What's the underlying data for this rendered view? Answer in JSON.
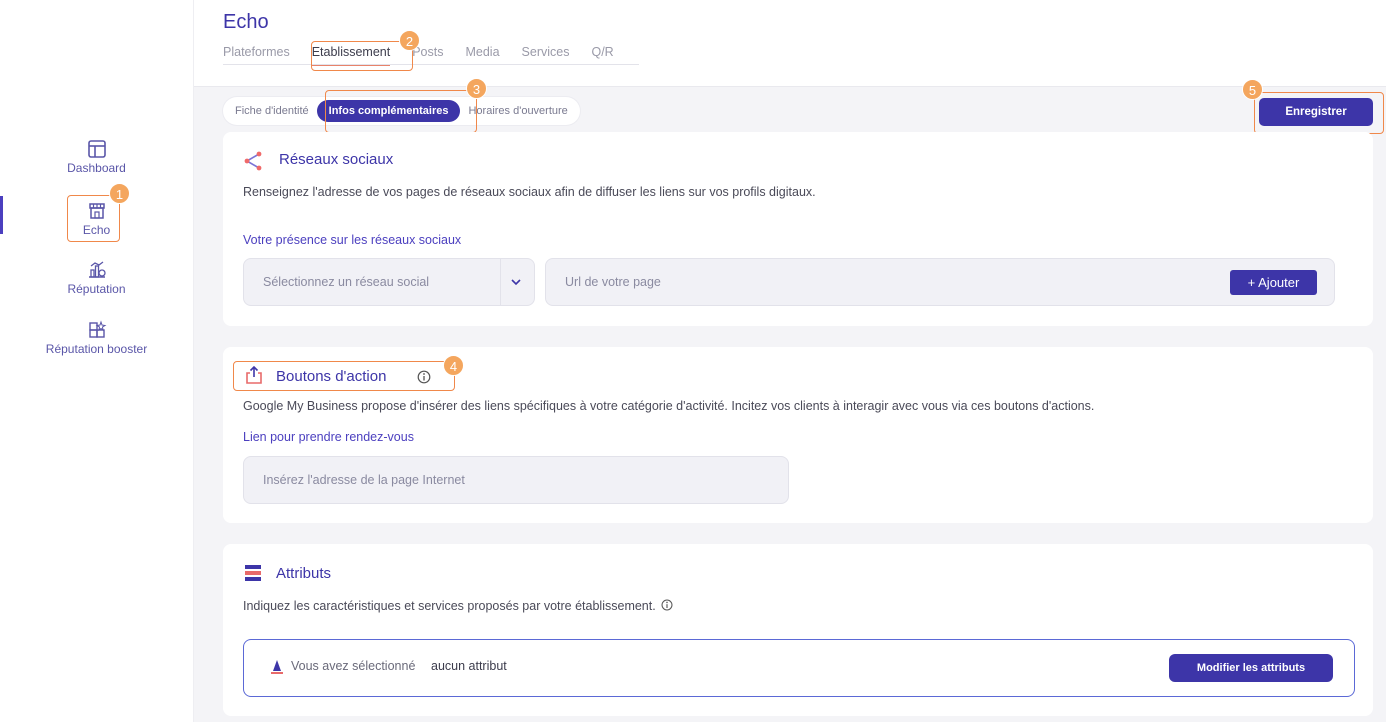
{
  "sidebar": {
    "items": [
      {
        "label": "Dashboard",
        "icon": "dashboard-icon"
      },
      {
        "label": "Echo",
        "icon": "store-icon"
      },
      {
        "label": "Réputation",
        "icon": "reputation-icon"
      },
      {
        "label": "Réputation booster",
        "icon": "booster-icon"
      }
    ]
  },
  "header": {
    "title": "Echo",
    "tabs": [
      "Plateformes",
      "Etablissement",
      "Posts",
      "Media",
      "Services",
      "Q/R"
    ]
  },
  "subtabs": [
    "Fiche d'identité",
    "Infos complémentaires",
    "Horaires d'ouverture"
  ],
  "save_label": "Enregistrer",
  "markers": [
    "1",
    "2",
    "3",
    "4",
    "5"
  ],
  "social": {
    "title": "Réseaux sociaux",
    "desc": "Renseignez l'adresse de vos pages de réseaux sociaux afin de diffuser les liens sur vos profils digitaux.",
    "label": "Votre présence sur les réseaux sociaux",
    "select_placeholder": "Sélectionnez un réseau social",
    "url_placeholder": "Url de votre page",
    "add_label": "Ajouter"
  },
  "actions": {
    "title": "Boutons d'action",
    "desc": "Google My Business propose d'insérer des liens spécifiques à votre catégorie d'activité. Incitez vos clients à interagir avec vous via ces boutons d'actions.",
    "label": "Lien pour prendre rendez-vous",
    "placeholder": "Insérez l'adresse de la page Internet"
  },
  "attributes": {
    "title": "Attributs",
    "desc": "Indiquez les caractéristiques et services proposés par votre établissement.",
    "selected_prefix": "Vous avez sélectionné",
    "selected_value": "aucun attribut",
    "modify_label": "Modifier les attributs"
  },
  "colors": {
    "accent": "#3d35a8",
    "highlight": "#f0884a",
    "marker": "#f4a65e"
  }
}
